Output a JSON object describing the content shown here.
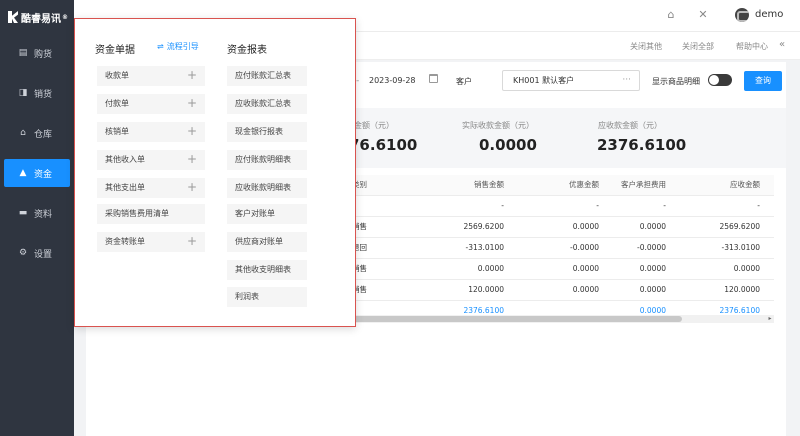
{
  "brand": {
    "name": "酷睿易讯",
    "reg": "®"
  },
  "sidebar": {
    "items": [
      {
        "label": "购货",
        "icon": "purchase-icon"
      },
      {
        "label": "销货",
        "icon": "sales-icon"
      },
      {
        "label": "仓库",
        "icon": "warehouse-icon"
      },
      {
        "label": "资金",
        "icon": "funds-icon",
        "active": true
      },
      {
        "label": "资料",
        "icon": "data-icon"
      },
      {
        "label": "设置",
        "icon": "settings-icon"
      }
    ]
  },
  "header": {
    "username": "demo",
    "home_icon": "home-icon",
    "tools_icon": "tools-icon"
  },
  "tabs": {
    "close_others": "关闭其他",
    "close_all": "关闭全部",
    "help": "帮助中心",
    "collapse": "«"
  },
  "filters": {
    "date_sep": "-",
    "date_end": "2023-09-28",
    "customer_label": "客户",
    "customer_value": "KH001 默认客户",
    "customer_more": "···",
    "show_detail_label": "显示商品明细",
    "query_label": "查询"
  },
  "summary": {
    "labels": [
      "金额（元）",
      "实际收款金额（元）",
      "应收款金额（元）"
    ],
    "values": [
      "76.6100",
      "0.0000",
      "2376.6100"
    ]
  },
  "table": {
    "headers": [
      "类别",
      "销售金额",
      "优惠金额",
      "客户承担费用",
      "应收金额"
    ],
    "rows": [
      [
        "",
        "-",
        "-",
        "-",
        "-"
      ],
      [
        "销售",
        "2569.6200",
        "0.0000",
        "0.0000",
        "2569.6200"
      ],
      [
        "退回",
        "-313.0100",
        "-0.0000",
        "-0.0000",
        "-313.0100"
      ],
      [
        "销售",
        "0.0000",
        "0.0000",
        "0.0000",
        "0.0000"
      ],
      [
        "销售",
        "120.0000",
        "0.0000",
        "0.0000",
        "120.0000"
      ]
    ],
    "total": [
      "",
      "2376.6100",
      "",
      "0.0000",
      "2376.6100"
    ]
  },
  "menu": {
    "col1_title": "资金单据",
    "flow_guide": "流程引导",
    "col1_items": [
      {
        "label": "收款单",
        "plus": "+"
      },
      {
        "label": "付款单",
        "plus": "+"
      },
      {
        "label": "核销单",
        "plus": "+"
      },
      {
        "label": "其他收入单",
        "plus": "+"
      },
      {
        "label": "其他支出单",
        "plus": "+"
      },
      {
        "label": "采购销售费用清单",
        "plus": ""
      },
      {
        "label": "资金转账单",
        "plus": "+"
      }
    ],
    "col2_title": "资金报表",
    "col2_items": [
      "应付账款汇总表",
      "应收账款汇总表",
      "现金银行报表",
      "应付账款明细表",
      "应收账款明细表",
      "客户对账单",
      "供应商对账单",
      "其他收支明细表",
      "利润表"
    ]
  }
}
